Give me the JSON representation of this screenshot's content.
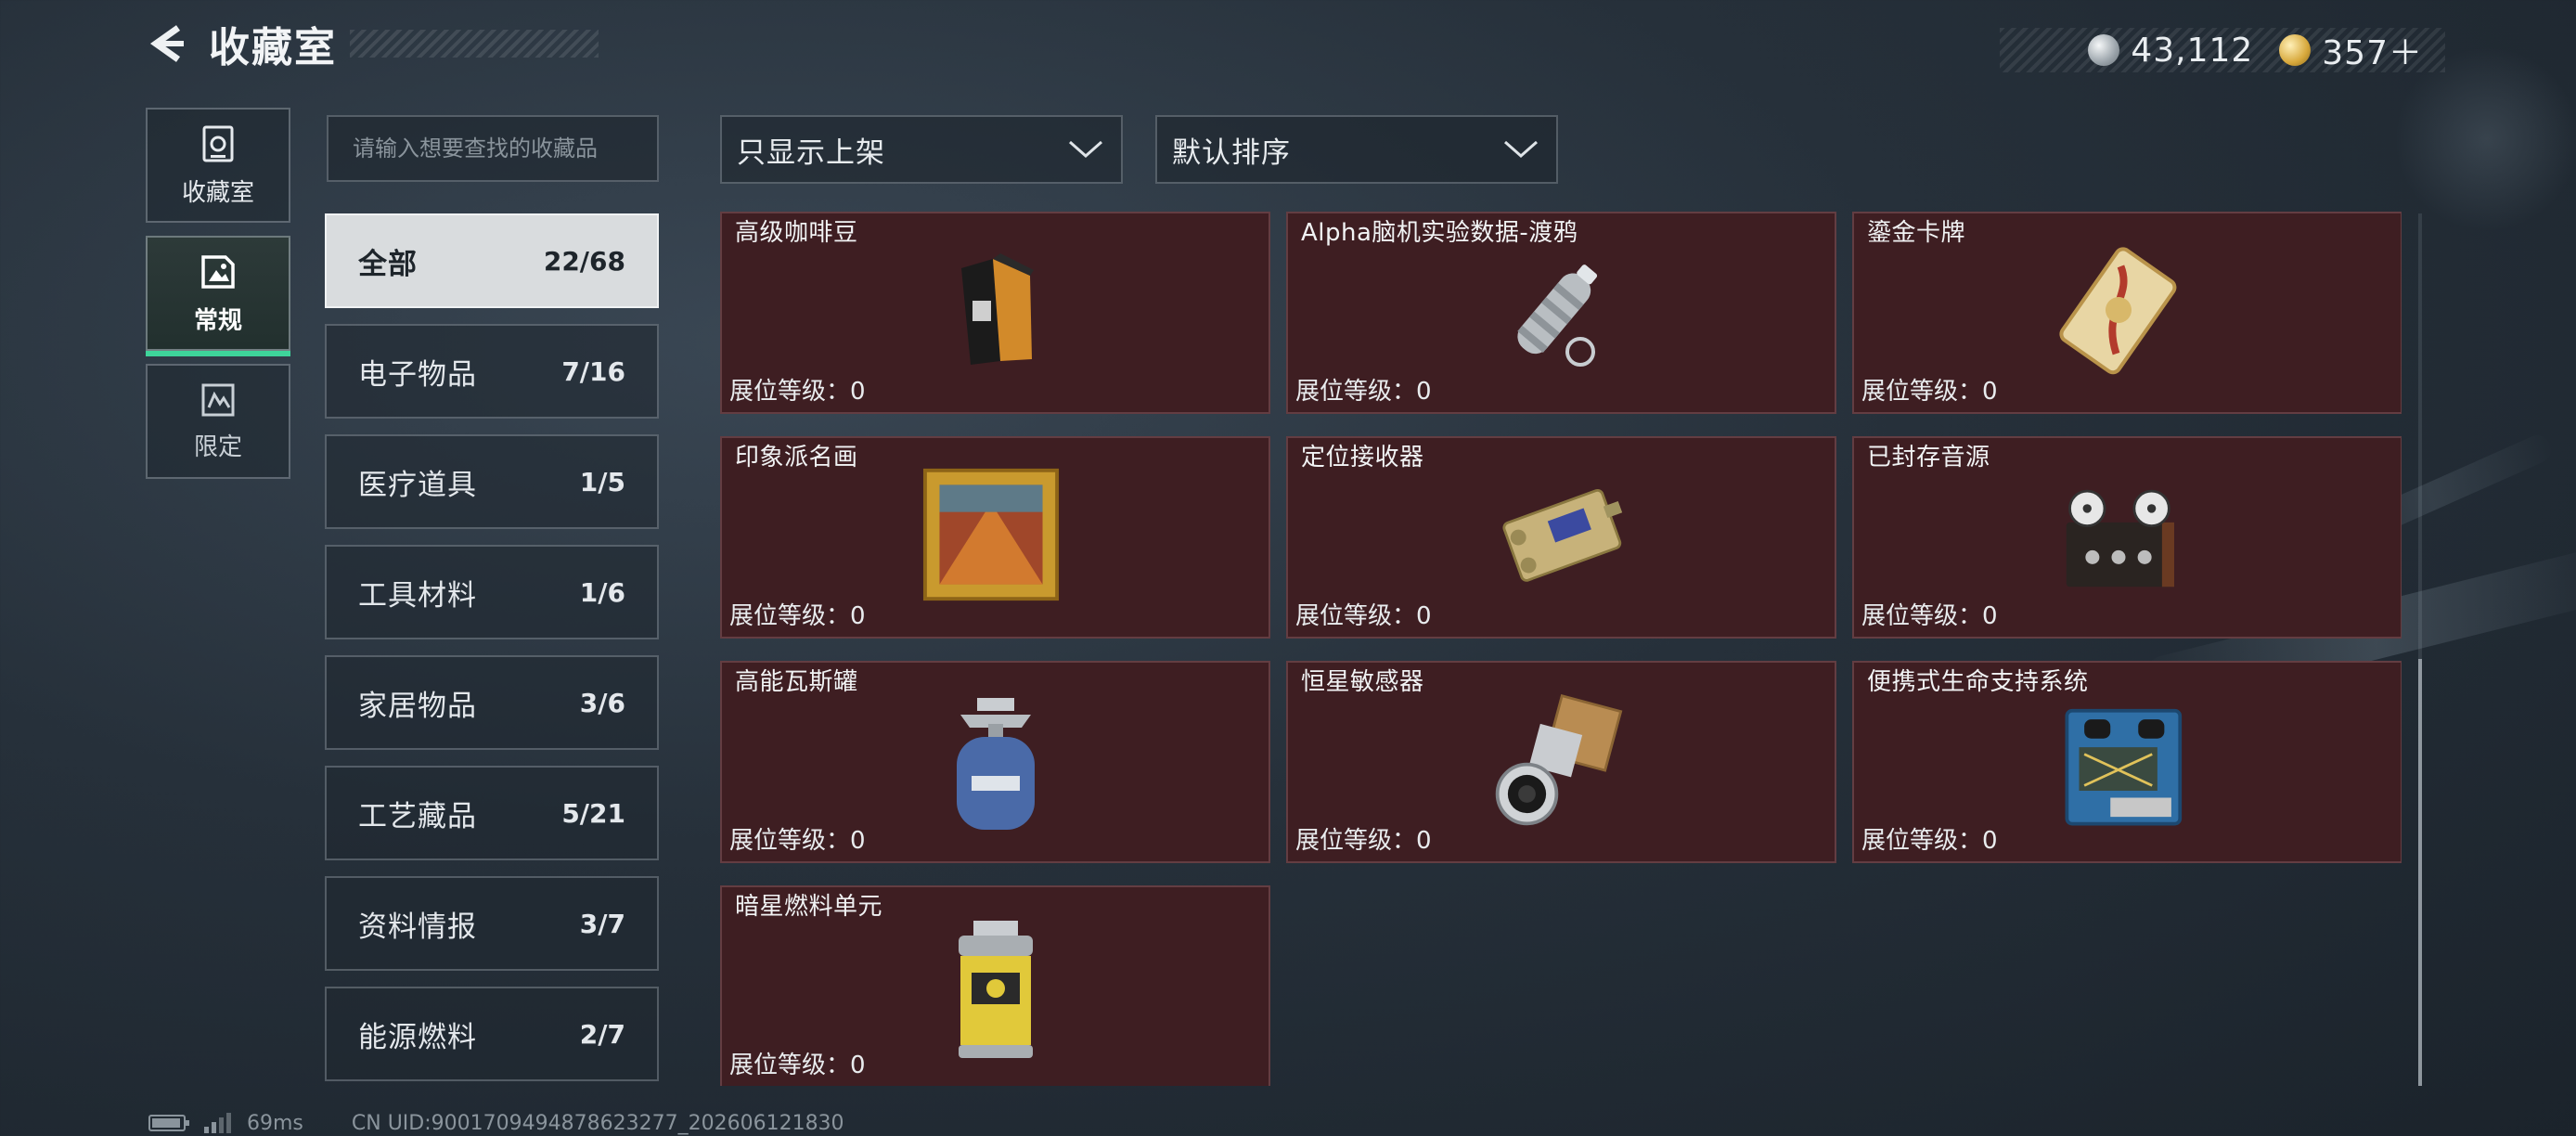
{
  "header": {
    "title": "收藏室",
    "back_icon": "back-arrow-icon"
  },
  "currency": [
    {
      "icon": "silver-coin-icon",
      "value": "43,112"
    },
    {
      "icon": "gold-coin-icon",
      "value": "357＋"
    }
  ],
  "rail": [
    {
      "label": "收藏室",
      "icon": "collection-room-icon",
      "active": false
    },
    {
      "label": "常规",
      "icon": "regular-icon",
      "active": true
    },
    {
      "label": "限定",
      "icon": "limited-icon",
      "active": false
    }
  ],
  "search": {
    "placeholder": "请输入想要查找的收藏品",
    "value": ""
  },
  "categories": [
    {
      "name": "全部",
      "count": "22/68",
      "active": true
    },
    {
      "name": "电子物品",
      "count": "7/16",
      "active": false
    },
    {
      "name": "医疗道具",
      "count": "1/5",
      "active": false
    },
    {
      "name": "工具材料",
      "count": "1/6",
      "active": false
    },
    {
      "name": "家居物品",
      "count": "3/6",
      "active": false
    },
    {
      "name": "工艺藏品",
      "count": "5/21",
      "active": false
    },
    {
      "name": "资料情报",
      "count": "3/7",
      "active": false
    },
    {
      "name": "能源燃料",
      "count": "2/7",
      "active": false
    }
  ],
  "filters": {
    "display_filter": "只显示上架",
    "sort": "默认排序",
    "chevron_icon": "chevron-down-icon"
  },
  "items": [
    {
      "name": "高级咖啡豆",
      "level_label": "展位等级：",
      "level": "0",
      "icon": "coffee-bag-icon"
    },
    {
      "name": "Alpha脑机实验数据-渡鸦",
      "level_label": "展位等级：",
      "level": "0",
      "icon": "data-canister-icon"
    },
    {
      "name": "鎏金卡牌",
      "level_label": "展位等级：",
      "level": "0",
      "icon": "gold-card-icon"
    },
    {
      "name": "印象派名画",
      "level_label": "展位等级：",
      "level": "0",
      "icon": "painting-icon"
    },
    {
      "name": "定位接收器",
      "level_label": "展位等级：",
      "level": "0",
      "icon": "receiver-icon"
    },
    {
      "name": "已封存音源",
      "level_label": "展位等级：",
      "level": "0",
      "icon": "reel-recorder-icon"
    },
    {
      "name": "高能瓦斯罐",
      "level_label": "展位等级：",
      "level": "0",
      "icon": "gas-tank-icon"
    },
    {
      "name": "恒星敏感器",
      "level_label": "展位等级：",
      "level": "0",
      "icon": "star-sensor-icon"
    },
    {
      "name": "便携式生命支持系统",
      "level_label": "展位等级：",
      "level": "0",
      "icon": "life-support-icon"
    },
    {
      "name": "暗星燃料单元",
      "level_label": "展位等级：",
      "level": "0",
      "icon": "fuel-cell-icon"
    }
  ],
  "footer": {
    "battery_icon": "battery-icon",
    "signal_icon": "signal-icon",
    "ping": "69ms",
    "uid": "CN UID:9001709494878623277_202606121830"
  },
  "colors": {
    "accent": "#3ed49a",
    "card_bg": "#3e1e22",
    "active_tab": "#d9dcde"
  }
}
